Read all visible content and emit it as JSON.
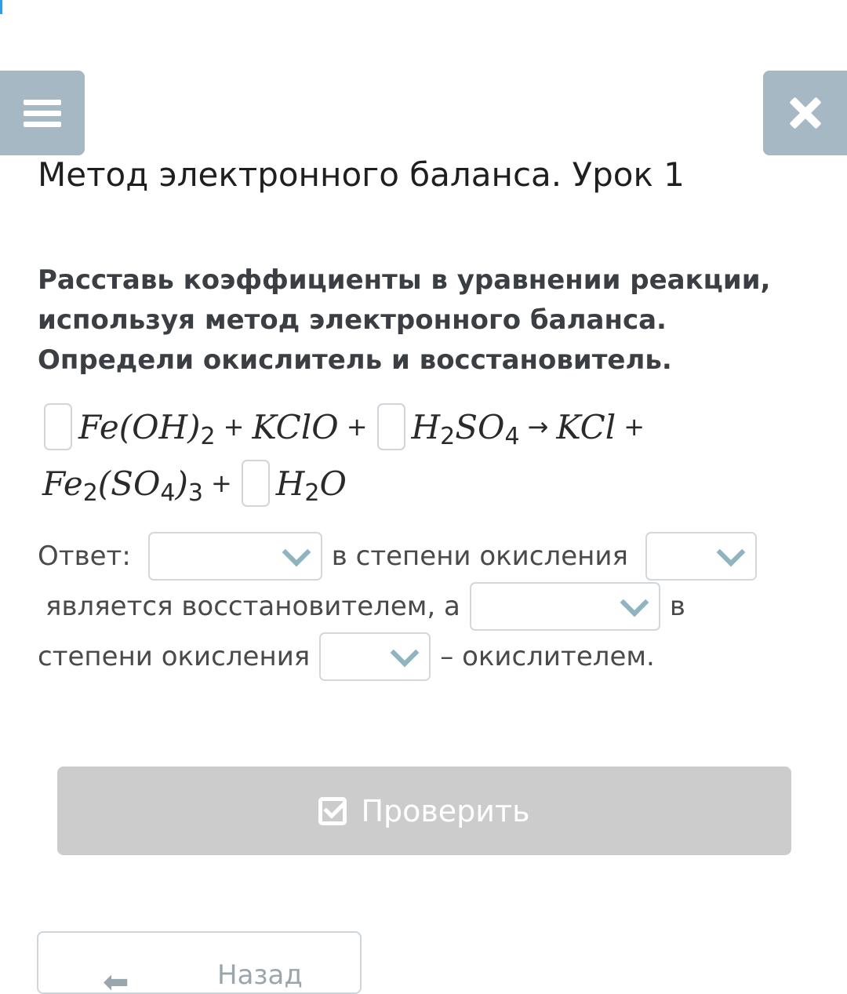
{
  "header": {
    "menu_icon": "hamburger-icon",
    "close_icon": "close-icon"
  },
  "lesson": {
    "title": "Метод электронного баланса. Урок 1"
  },
  "task": {
    "instructions": "Расставь коэффициенты в уравнении реакции, используя метод электронного баланса. Определи окислитель и восстановитель."
  },
  "equation": {
    "line1": {
      "term1": "Fe(OH)",
      "term1_sub": "2",
      "plus1": "+",
      "term2": "KClO",
      "plus2": "+",
      "term3_a": "H",
      "term3_sub1": "2",
      "term3_b": "SO",
      "term3_sub2": "4",
      "arrow": "→",
      "term4": "KCl",
      "plus3": "+"
    },
    "line2": {
      "term5_a": "Fe",
      "term5_sub1": "2",
      "term5_b": "(SO",
      "term5_sub2": "4",
      "term5_c": ")",
      "term5_sub3": "3",
      "plus4": "+",
      "term6_a": "H",
      "term6_sub": "2",
      "term6_b": "O"
    }
  },
  "answer": {
    "label": "Ответ:",
    "text1": "в степени окисления",
    "text2": "является восстановителем, а",
    "text3": "в",
    "text4": "степени окисления",
    "text5": "– окислителем."
  },
  "actions": {
    "check_label": "Проверить",
    "check_icon": "checkbox-icon",
    "back_label": "Назад",
    "back_icon": "arrow-left-icon"
  },
  "colors": {
    "header_button": "#a6b8c4",
    "check_button_disabled": "#cccccc",
    "chevron": "#8fb4bf",
    "accent": "#2f9ee6"
  }
}
